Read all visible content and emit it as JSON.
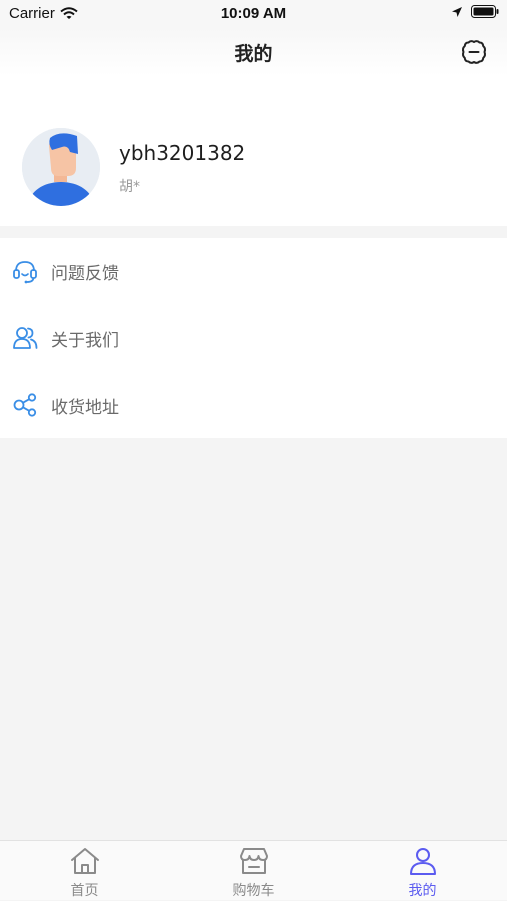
{
  "status_bar": {
    "carrier": "Carrier",
    "time": "10:09 AM"
  },
  "header": {
    "title": "我的",
    "settings_icon": "settings-gear-icon"
  },
  "profile": {
    "username": "ybh3201382",
    "real_name": "胡*"
  },
  "menu": {
    "items": [
      {
        "label": "问题反馈",
        "icon": "headset-icon"
      },
      {
        "label": "关于我们",
        "icon": "users-icon"
      },
      {
        "label": "收货地址",
        "icon": "share-nodes-icon"
      }
    ]
  },
  "tabbar": {
    "tabs": [
      {
        "label": "首页",
        "icon": "home-icon",
        "active": false
      },
      {
        "label": "购物车",
        "icon": "store-icon",
        "active": false
      },
      {
        "label": "我的",
        "icon": "user-icon",
        "active": true
      }
    ]
  },
  "colors": {
    "accent": "#5b5bf0",
    "menu_icon": "#3a8ee6",
    "background": "#f4f4f4"
  }
}
